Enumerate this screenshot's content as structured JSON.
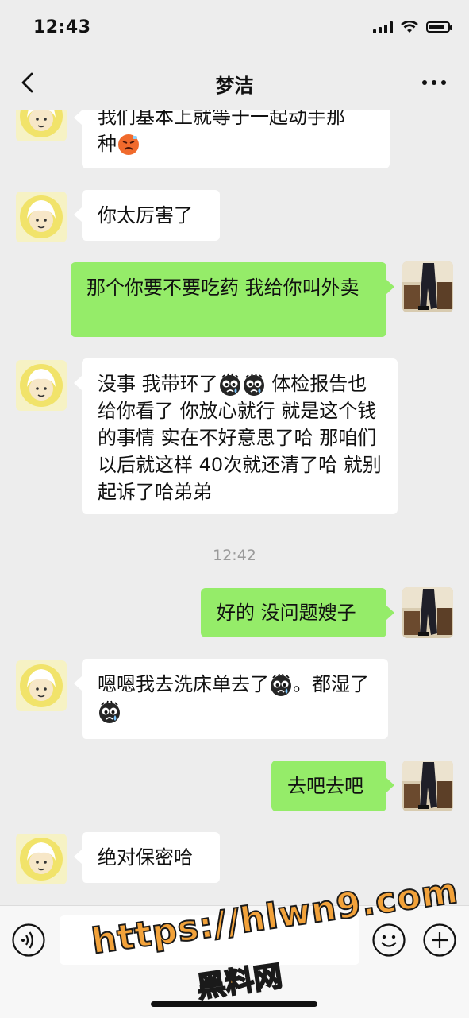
{
  "status_bar": {
    "time": "12:43"
  },
  "nav": {
    "title": "梦洁"
  },
  "messages": {
    "m0": {
      "text_line1": "我们基本上就等于一起动手那",
      "text_line2": "种"
    },
    "m1": {
      "text": "你太厉害了"
    },
    "m2": {
      "text": "那个你要不要吃药 我给你叫外卖"
    },
    "m3": {
      "part1": "没事 我带环了",
      "part2": " 体检报告也给你看了 你放心就行 就是这个钱的事情 实在不好意思了哈 那咱们以后就这样 40次就还清了哈 就别起诉了哈弟弟"
    },
    "timestamp": "12:42",
    "m4": {
      "text": "好的 没问题嫂子"
    },
    "m5": {
      "part1": " 嗯嗯我去洗床单去了",
      "part2": "。都湿了"
    },
    "m6": {
      "text": "去吧去吧"
    },
    "m7": {
      "text": "绝对保密哈"
    }
  },
  "watermark": {
    "line1": "https://hlwn9.com",
    "line2": "黑料网"
  },
  "icons": {
    "back": "chevron-left-icon",
    "more": "more-dots-icon",
    "voice": "voice-icon",
    "emoji": "smile-icon",
    "plus": "plus-icon",
    "sticker_angry": "angry-face-icon",
    "sticker_cry": "crying-face-icon"
  },
  "colors": {
    "background": "#ededed",
    "my_bubble": "#95ec69",
    "their_bubble": "#ffffff",
    "watermark": "#f2a23a"
  }
}
